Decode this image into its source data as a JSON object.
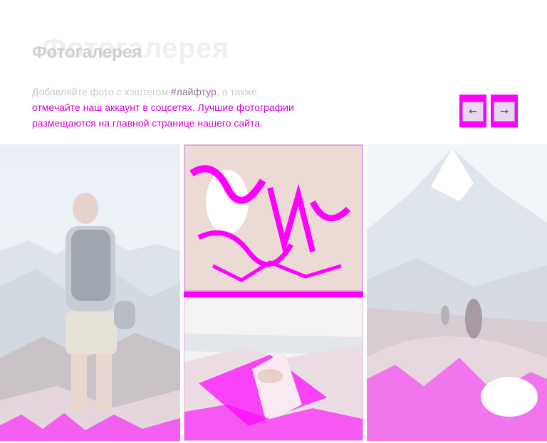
{
  "gallery_section": {
    "title": "Фотогалерея",
    "title_ghost": "Фотогалерея",
    "description_prefix": "Добавляйте фото с хэштегом ",
    "hashtag": "#лайфтур",
    "description_suffix": ", а также",
    "description_line2": "отмечайте наш аккаунт в соцсетях. Лучшие фотографии",
    "description_line3": "размещаются на главной странице нашего сайта.",
    "prev_label": "←",
    "next_label": "→"
  },
  "photos": [
    {
      "subject": "Hiker with backpack on mountain summit"
    },
    {
      "subject": "Sunlit forest"
    },
    {
      "subject": "Hands holding map over valley"
    },
    {
      "subject": "Volcano peak with hikers on trail"
    }
  ],
  "colors": {
    "accent": "#ff00ff",
    "title_gray": "#cfcfcf",
    "text_gray": "#c9c9c9"
  }
}
